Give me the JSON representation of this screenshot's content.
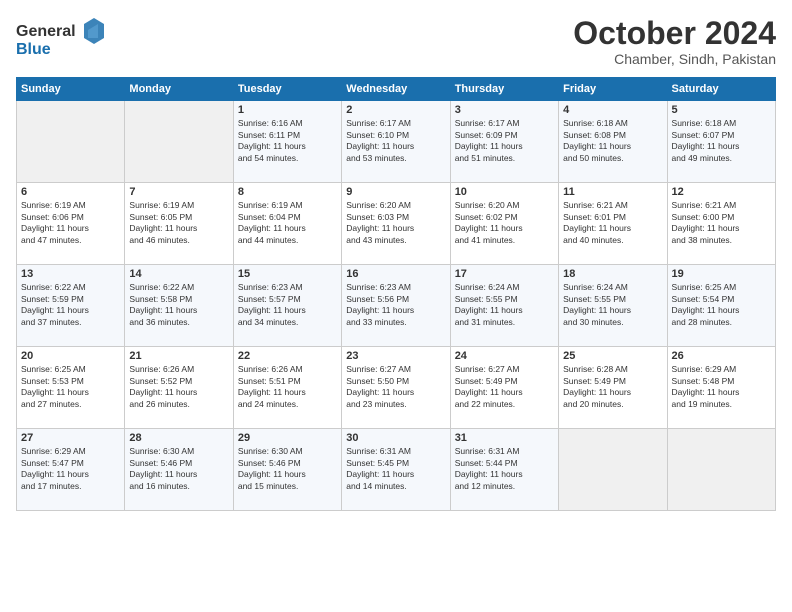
{
  "logo": {
    "line1": "General",
    "line2": "Blue"
  },
  "title": "October 2024",
  "subtitle": "Chamber, Sindh, Pakistan",
  "days_header": [
    "Sunday",
    "Monday",
    "Tuesday",
    "Wednesday",
    "Thursday",
    "Friday",
    "Saturday"
  ],
  "weeks": [
    [
      {
        "day": "",
        "info": ""
      },
      {
        "day": "",
        "info": ""
      },
      {
        "day": "1",
        "info": "Sunrise: 6:16 AM\nSunset: 6:11 PM\nDaylight: 11 hours\nand 54 minutes."
      },
      {
        "day": "2",
        "info": "Sunrise: 6:17 AM\nSunset: 6:10 PM\nDaylight: 11 hours\nand 53 minutes."
      },
      {
        "day": "3",
        "info": "Sunrise: 6:17 AM\nSunset: 6:09 PM\nDaylight: 11 hours\nand 51 minutes."
      },
      {
        "day": "4",
        "info": "Sunrise: 6:18 AM\nSunset: 6:08 PM\nDaylight: 11 hours\nand 50 minutes."
      },
      {
        "day": "5",
        "info": "Sunrise: 6:18 AM\nSunset: 6:07 PM\nDaylight: 11 hours\nand 49 minutes."
      }
    ],
    [
      {
        "day": "6",
        "info": "Sunrise: 6:19 AM\nSunset: 6:06 PM\nDaylight: 11 hours\nand 47 minutes."
      },
      {
        "day": "7",
        "info": "Sunrise: 6:19 AM\nSunset: 6:05 PM\nDaylight: 11 hours\nand 46 minutes."
      },
      {
        "day": "8",
        "info": "Sunrise: 6:19 AM\nSunset: 6:04 PM\nDaylight: 11 hours\nand 44 minutes."
      },
      {
        "day": "9",
        "info": "Sunrise: 6:20 AM\nSunset: 6:03 PM\nDaylight: 11 hours\nand 43 minutes."
      },
      {
        "day": "10",
        "info": "Sunrise: 6:20 AM\nSunset: 6:02 PM\nDaylight: 11 hours\nand 41 minutes."
      },
      {
        "day": "11",
        "info": "Sunrise: 6:21 AM\nSunset: 6:01 PM\nDaylight: 11 hours\nand 40 minutes."
      },
      {
        "day": "12",
        "info": "Sunrise: 6:21 AM\nSunset: 6:00 PM\nDaylight: 11 hours\nand 38 minutes."
      }
    ],
    [
      {
        "day": "13",
        "info": "Sunrise: 6:22 AM\nSunset: 5:59 PM\nDaylight: 11 hours\nand 37 minutes."
      },
      {
        "day": "14",
        "info": "Sunrise: 6:22 AM\nSunset: 5:58 PM\nDaylight: 11 hours\nand 36 minutes."
      },
      {
        "day": "15",
        "info": "Sunrise: 6:23 AM\nSunset: 5:57 PM\nDaylight: 11 hours\nand 34 minutes."
      },
      {
        "day": "16",
        "info": "Sunrise: 6:23 AM\nSunset: 5:56 PM\nDaylight: 11 hours\nand 33 minutes."
      },
      {
        "day": "17",
        "info": "Sunrise: 6:24 AM\nSunset: 5:55 PM\nDaylight: 11 hours\nand 31 minutes."
      },
      {
        "day": "18",
        "info": "Sunrise: 6:24 AM\nSunset: 5:55 PM\nDaylight: 11 hours\nand 30 minutes."
      },
      {
        "day": "19",
        "info": "Sunrise: 6:25 AM\nSunset: 5:54 PM\nDaylight: 11 hours\nand 28 minutes."
      }
    ],
    [
      {
        "day": "20",
        "info": "Sunrise: 6:25 AM\nSunset: 5:53 PM\nDaylight: 11 hours\nand 27 minutes."
      },
      {
        "day": "21",
        "info": "Sunrise: 6:26 AM\nSunset: 5:52 PM\nDaylight: 11 hours\nand 26 minutes."
      },
      {
        "day": "22",
        "info": "Sunrise: 6:26 AM\nSunset: 5:51 PM\nDaylight: 11 hours\nand 24 minutes."
      },
      {
        "day": "23",
        "info": "Sunrise: 6:27 AM\nSunset: 5:50 PM\nDaylight: 11 hours\nand 23 minutes."
      },
      {
        "day": "24",
        "info": "Sunrise: 6:27 AM\nSunset: 5:49 PM\nDaylight: 11 hours\nand 22 minutes."
      },
      {
        "day": "25",
        "info": "Sunrise: 6:28 AM\nSunset: 5:49 PM\nDaylight: 11 hours\nand 20 minutes."
      },
      {
        "day": "26",
        "info": "Sunrise: 6:29 AM\nSunset: 5:48 PM\nDaylight: 11 hours\nand 19 minutes."
      }
    ],
    [
      {
        "day": "27",
        "info": "Sunrise: 6:29 AM\nSunset: 5:47 PM\nDaylight: 11 hours\nand 17 minutes."
      },
      {
        "day": "28",
        "info": "Sunrise: 6:30 AM\nSunset: 5:46 PM\nDaylight: 11 hours\nand 16 minutes."
      },
      {
        "day": "29",
        "info": "Sunrise: 6:30 AM\nSunset: 5:46 PM\nDaylight: 11 hours\nand 15 minutes."
      },
      {
        "day": "30",
        "info": "Sunrise: 6:31 AM\nSunset: 5:45 PM\nDaylight: 11 hours\nand 14 minutes."
      },
      {
        "day": "31",
        "info": "Sunrise: 6:31 AM\nSunset: 5:44 PM\nDaylight: 11 hours\nand 12 minutes."
      },
      {
        "day": "",
        "info": ""
      },
      {
        "day": "",
        "info": ""
      }
    ]
  ]
}
